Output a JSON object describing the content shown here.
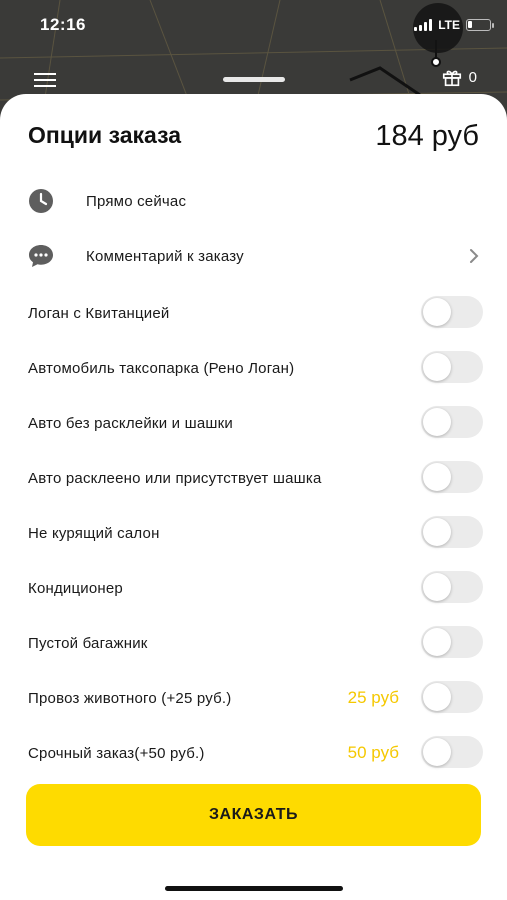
{
  "status_bar": {
    "time": "12:16",
    "network": "LTE",
    "icons": [
      "signal-icon",
      "battery-icon"
    ]
  },
  "map": {
    "gift_count": "0",
    "icons": [
      "menu-icon",
      "gift-icon"
    ]
  },
  "sheet": {
    "title": "Опции заказа",
    "price": "184 руб",
    "time_row": {
      "label": "Прямо сейчас",
      "icon": "clock-icon"
    },
    "comment_row": {
      "label": "Комментарий к заказу",
      "icon": "comment-icon",
      "chevron": "chevron-right-icon"
    },
    "options": [
      {
        "label": "Логан с Квитанцией",
        "price": "",
        "enabled": false
      },
      {
        "label": "Автомобиль таксопарка (Рено Логан)",
        "price": "",
        "enabled": false
      },
      {
        "label": "Авто без расклейки и шашки",
        "price": "",
        "enabled": false
      },
      {
        "label": "Авто расклеено или присутствует шашка",
        "price": "",
        "enabled": false
      },
      {
        "label": "Не курящий салон",
        "price": "",
        "enabled": false
      },
      {
        "label": "Кондиционер",
        "price": "",
        "enabled": false
      },
      {
        "label": "Пустой багажник",
        "price": "",
        "enabled": false
      },
      {
        "label": "Провоз животного (+25 руб.)",
        "price": "25 руб",
        "enabled": false
      },
      {
        "label": "Срочный заказ(+50 руб.)",
        "price": "50 руб",
        "enabled": false
      }
    ],
    "order_button": "ЗАКАЗАТЬ"
  },
  "colors": {
    "accent_yellow": "#fedb00",
    "price_yellow": "#f5c800",
    "toggle_off": "#ebebeb"
  }
}
